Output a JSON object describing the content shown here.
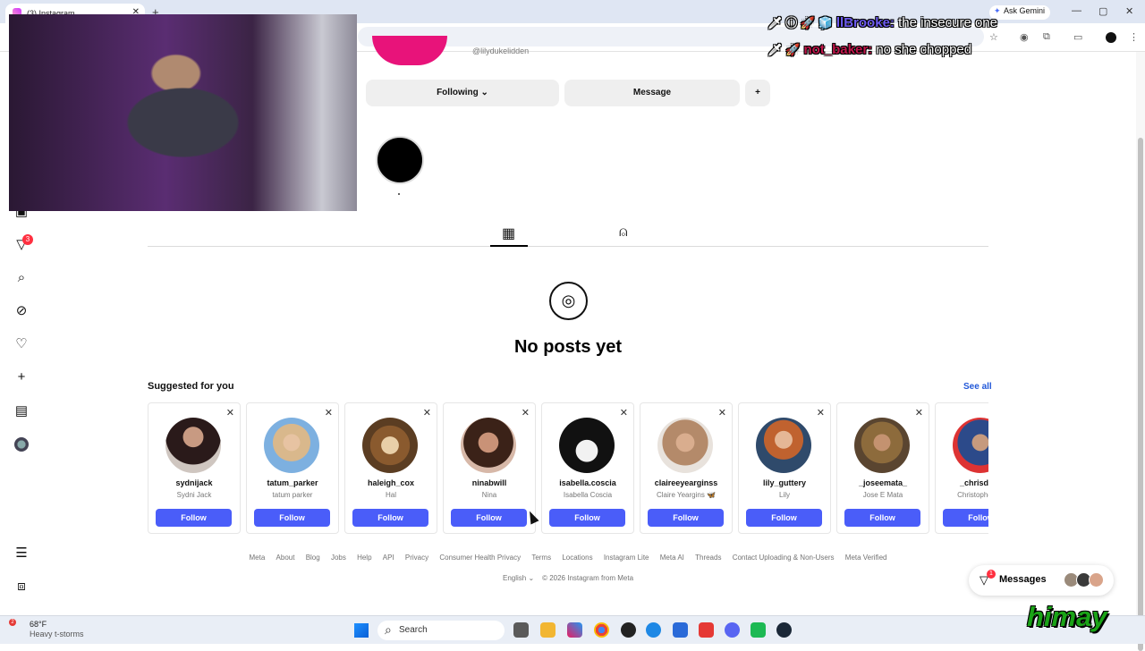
{
  "browser": {
    "tab_title": "(3) Instagram",
    "new_tab_symbol": "+",
    "close_symbol": "✕",
    "ask_gemini": "Ask Gemini",
    "minimize": "—",
    "maximize": "▢",
    "close": "✕"
  },
  "chat_overlay": {
    "messages": [
      {
        "emotes": "🗡 ⓘ 🚀 🧊",
        "user": "llBrooke:",
        "text": "the insecure one"
      },
      {
        "emotes": "🗡 🚀",
        "user": "not_baker:",
        "text": "no she chopped"
      }
    ]
  },
  "profile": {
    "handle": "@lilydukelidden",
    "following_label": "Following",
    "following_chevron": "⌄",
    "message_label": "Message",
    "add_user_icon": "person-add-icon"
  },
  "sidenav": {
    "notification_count": "3",
    "icons": [
      "reels-icon",
      "notifications-icon",
      "search-icon",
      "explore-icon",
      "likes-icon",
      "create-icon",
      "dashboard-icon",
      "profile-avatar",
      "menu-icon",
      "more-apps-icon"
    ]
  },
  "tabs": {
    "posts_icon": "grid-icon",
    "tagged_icon": "tagged-icon"
  },
  "empty_state": {
    "title": "No posts yet"
  },
  "suggestions": {
    "heading": "Suggested for you",
    "see_all": "See all",
    "follow_label": "Follow",
    "dismiss_symbol": "✕",
    "cards": [
      {
        "username": "sydnijack",
        "name": "Sydni Jack"
      },
      {
        "username": "tatum_parker",
        "name": "tatum parker"
      },
      {
        "username": "haleigh_cox",
        "name": "Hal"
      },
      {
        "username": "ninabwill",
        "name": "Nina"
      },
      {
        "username": "isabella.coscia",
        "name": "Isabella Coscia"
      },
      {
        "username": "claireeyearginss",
        "name": "Claire Yeargins 🦋"
      },
      {
        "username": "lily_guttery",
        "name": "Lily"
      },
      {
        "username": "_joseemata_",
        "name": "Jose E Mata"
      },
      {
        "username": "_chrisdomi",
        "name": "Christopher Do"
      }
    ]
  },
  "footer": {
    "links": [
      "Meta",
      "About",
      "Blog",
      "Jobs",
      "Help",
      "API",
      "Privacy",
      "Consumer Health Privacy",
      "Terms",
      "Locations",
      "Instagram Lite",
      "Meta AI",
      "Threads",
      "Contact Uploading & Non-Users",
      "Meta Verified"
    ],
    "language": "English",
    "language_chevron": "⌄",
    "copyright": "© 2026 Instagram from Meta"
  },
  "messages_pill": {
    "label": "Messages",
    "badge": "1"
  },
  "taskbar": {
    "temperature": "68°F",
    "condition": "Heavy t-storms",
    "weather_badge": "2",
    "search_label": "Search"
  },
  "watermark": {
    "text": "himay"
  },
  "colors": {
    "follow_button": "#4a5df9",
    "link_blue": "#2258d8",
    "badge_red": "#ff3040",
    "profile_ring": "#e8137a"
  }
}
